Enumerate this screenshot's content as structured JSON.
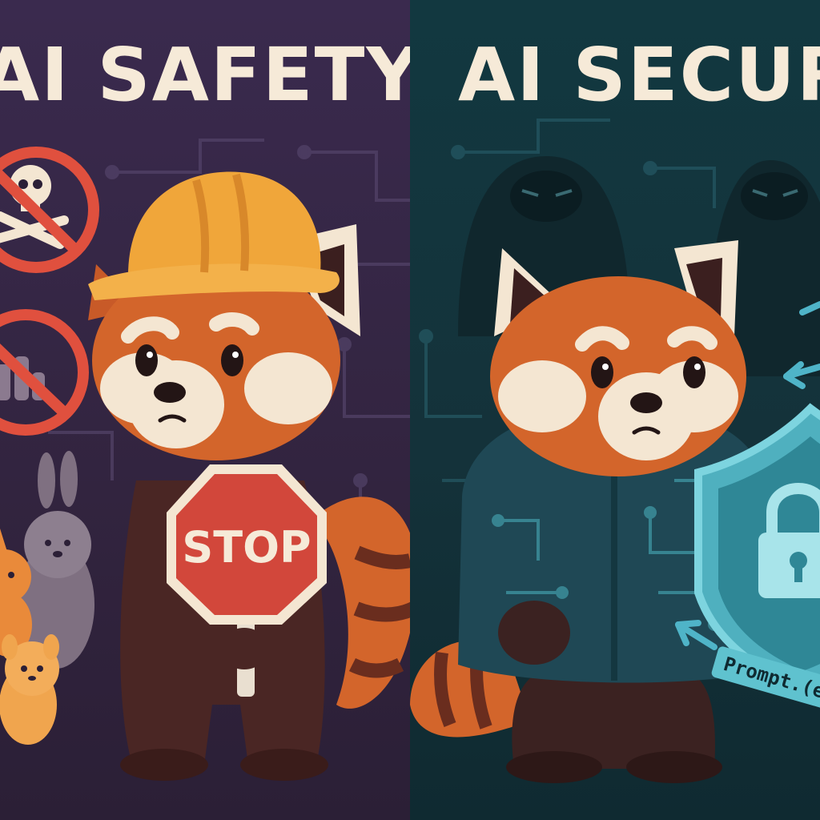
{
  "left_panel": {
    "title": "AI SAFETY",
    "stop_sign_text": "STOP",
    "colors": {
      "background": "#3a2a4e",
      "accent": "#e0503e",
      "hard_hat": "#f0a63a"
    },
    "icons": [
      "no-poison-icon",
      "no-harm-icon"
    ]
  },
  "right_panel": {
    "title": "AI SECURIT",
    "banner_text": "Prompt.(ejo.ce",
    "colors": {
      "background": "#123840",
      "shield": "#5fc2cf",
      "accent": "#4fb4c8"
    },
    "icons": [
      "shield-lock-icon",
      "arrow-icon"
    ]
  }
}
